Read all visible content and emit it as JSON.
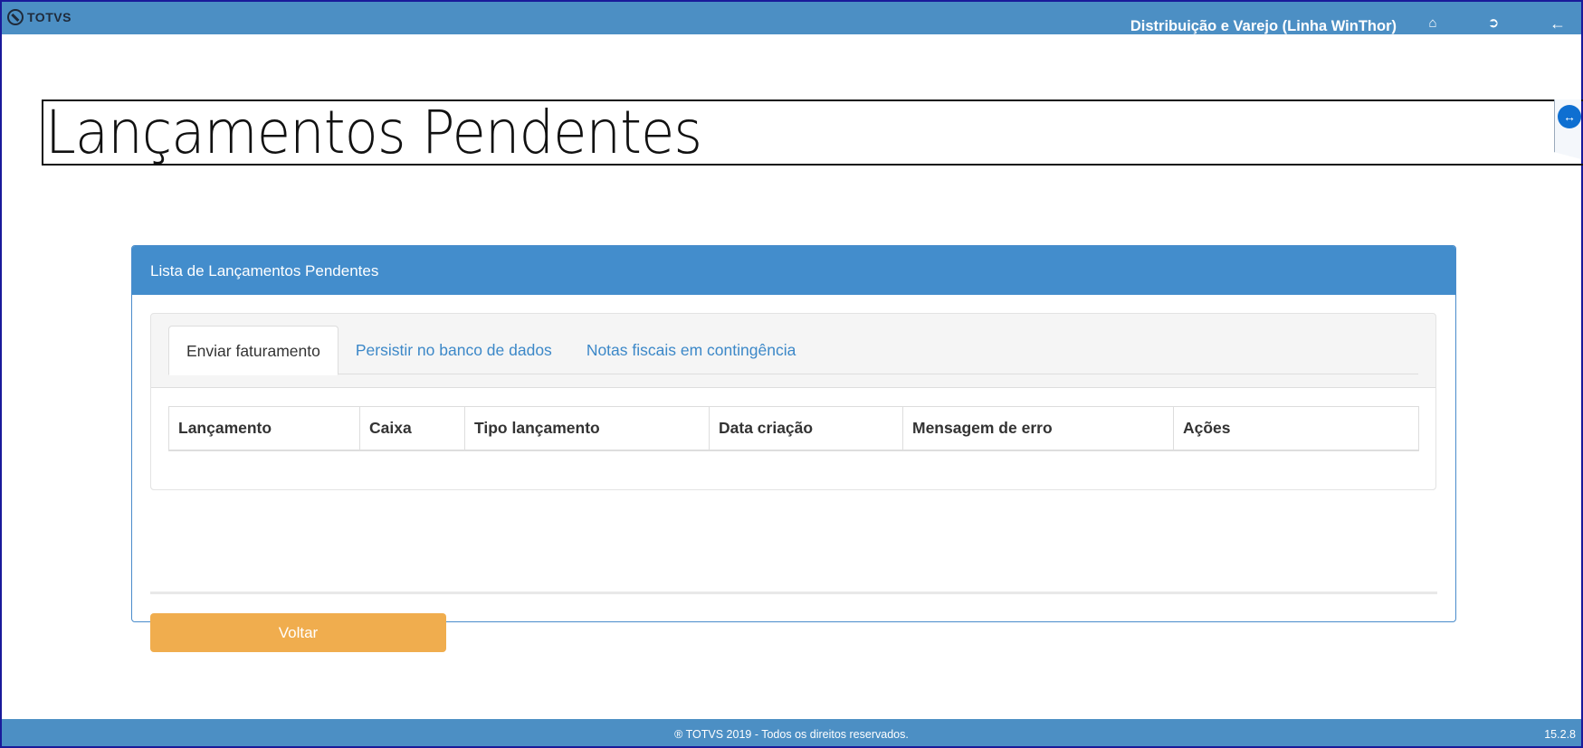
{
  "app": {
    "logo_text": "TOTVS",
    "product_title": "Distribuição e Varejo (Linha WinThor)"
  },
  "icons": {
    "home": "home-icon",
    "logout": "sign-out-icon",
    "back": "arrow-left-icon"
  },
  "page": {
    "title": "Lançamentos Pendentes"
  },
  "panel": {
    "heading": "Lista de Lançamentos Pendentes",
    "tabs": [
      {
        "label": "Enviar faturamento",
        "active": true
      },
      {
        "label": "Persistir no banco de dados",
        "active": false
      },
      {
        "label": "Notas fiscais em contingência",
        "active": false
      }
    ],
    "table": {
      "columns": [
        "Lançamento",
        "Caixa",
        "Tipo lançamento",
        "Data criação",
        "Mensagem de erro",
        "Ações"
      ],
      "rows": []
    },
    "back_button": "Voltar"
  },
  "footer": {
    "copyright": "® TOTVS 2019 - Todos os direitos reservados.",
    "version": "15.2.8"
  },
  "colors": {
    "topbar": "#4c8fc4",
    "panel_heading": "#438dcc",
    "tab_link": "#3c88c8",
    "warning_button": "#f0ad4e"
  }
}
